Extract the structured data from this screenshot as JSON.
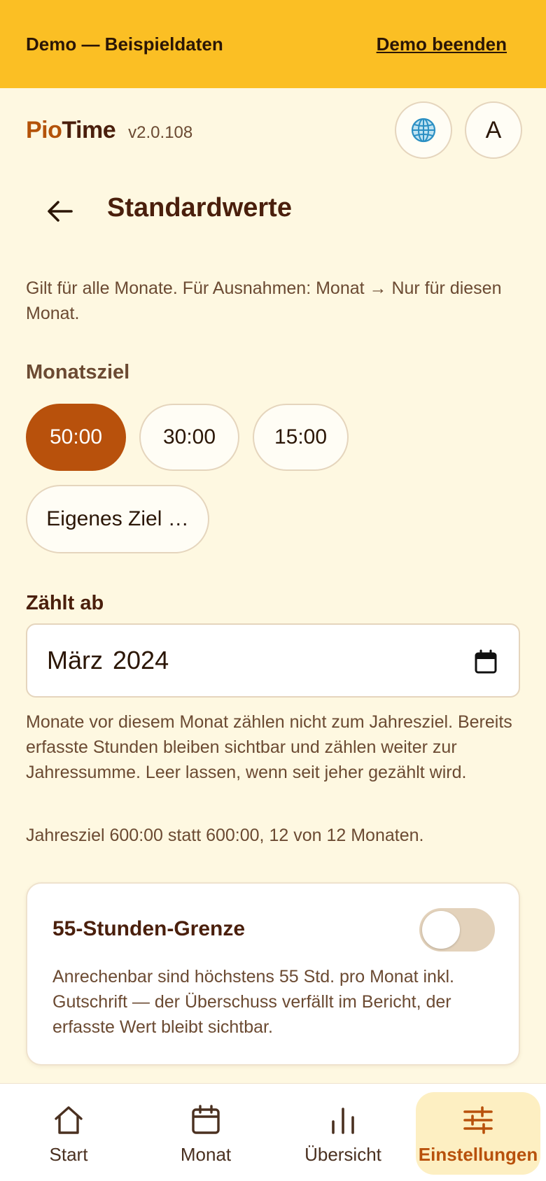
{
  "demo_bar": {
    "title": "Demo — Beispieldaten",
    "end_label": "Demo beenden"
  },
  "header": {
    "brand_pio": "Pio",
    "brand_time": "Time",
    "version": "v2.0.108",
    "avatar_initial": "A"
  },
  "page": {
    "title": "Standardwerte",
    "intro": "Gilt für alle Monate. Für Ausnahmen: Monat → Nur für diesen Monat."
  },
  "monthly_goal": {
    "label": "Monatsziel",
    "options": [
      "50:00",
      "30:00",
      "15:00"
    ],
    "selected": "50:00",
    "custom_label": "Eigenes Ziel …"
  },
  "counts_from": {
    "label": "Zählt ab",
    "value": "März 2024",
    "help": "Monate vor diesem Monat zählen nicht zum Jahresziel. Bereits erfasste Stunden bleiben sichtbar und zählen weiter zur Jahressumme. Leer lassen, wenn seit jeher gezählt wird.",
    "summary": "Jahresziel 600:00 statt 600:00, 12 von 12 Monaten."
  },
  "limit_card": {
    "title": "55-Stunden-Grenze",
    "enabled": false,
    "description": "Anrechenbar sind höchstens 55 Std. pro Monat inkl. Gutschrift — der Überschuss verfällt im Bericht, der erfasste Wert bleibt sichtbar."
  },
  "bottom_nav": {
    "items": [
      {
        "label": "Start",
        "icon": "home-icon"
      },
      {
        "label": "Monat",
        "icon": "calendar-icon"
      },
      {
        "label": "Übersicht",
        "icon": "bar-chart-icon"
      },
      {
        "label": "Einstellungen",
        "icon": "sliders-icon"
      }
    ],
    "active": "Einstellungen"
  },
  "colors": {
    "accent": "#b8510c",
    "brand": "#b45309",
    "demo_bar": "#fbbf24",
    "background": "#fef8e1"
  }
}
